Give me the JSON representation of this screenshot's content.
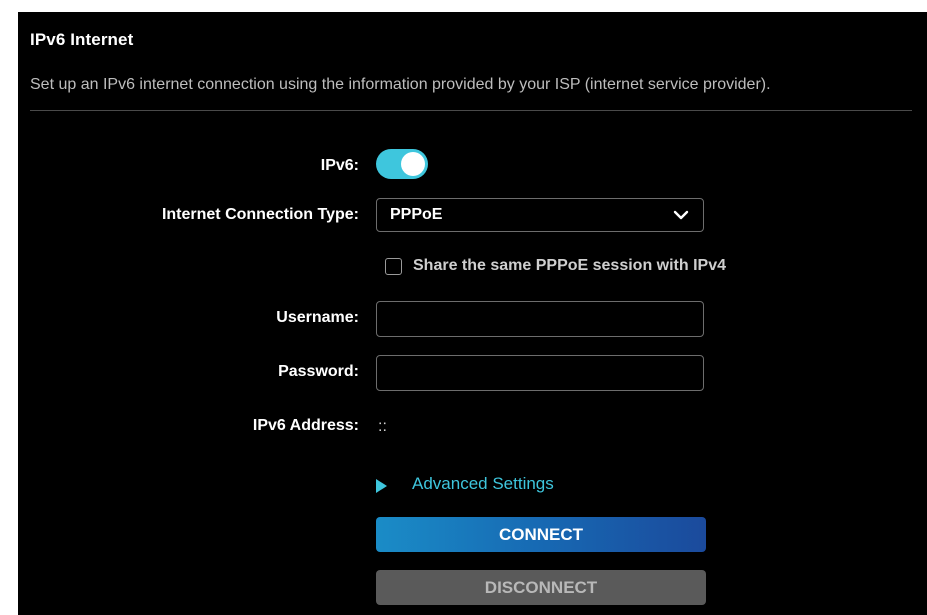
{
  "section": {
    "title": "IPv6 Internet",
    "description": "Set up an IPv6 internet connection using the information provided by your ISP (internet service provider)."
  },
  "form": {
    "ipv6": {
      "label": "IPv6:",
      "enabled": true,
      "accent_color": "#3ec6dd"
    },
    "connection_type": {
      "label": "Internet Connection Type:",
      "selected": "PPPoE",
      "icon": "chevron-down-icon"
    },
    "share_session": {
      "label": "Share the same PPPoE session with IPv4",
      "checked": false
    },
    "username": {
      "label": "Username:",
      "value": ""
    },
    "password": {
      "label": "Password:",
      "value": ""
    },
    "ipv6_address": {
      "label": "IPv6 Address:",
      "value": "::"
    },
    "advanced": {
      "label": "Advanced Settings",
      "icon": "triangle-right-icon",
      "color": "#3ec6dd"
    }
  },
  "buttons": {
    "connect": "CONNECT",
    "disconnect": "DISCONNECT"
  },
  "colors": {
    "background": "#000000",
    "accent": "#3ec6dd",
    "connect_button": "#1769b3",
    "disconnect_button": "#5a5a5a"
  }
}
